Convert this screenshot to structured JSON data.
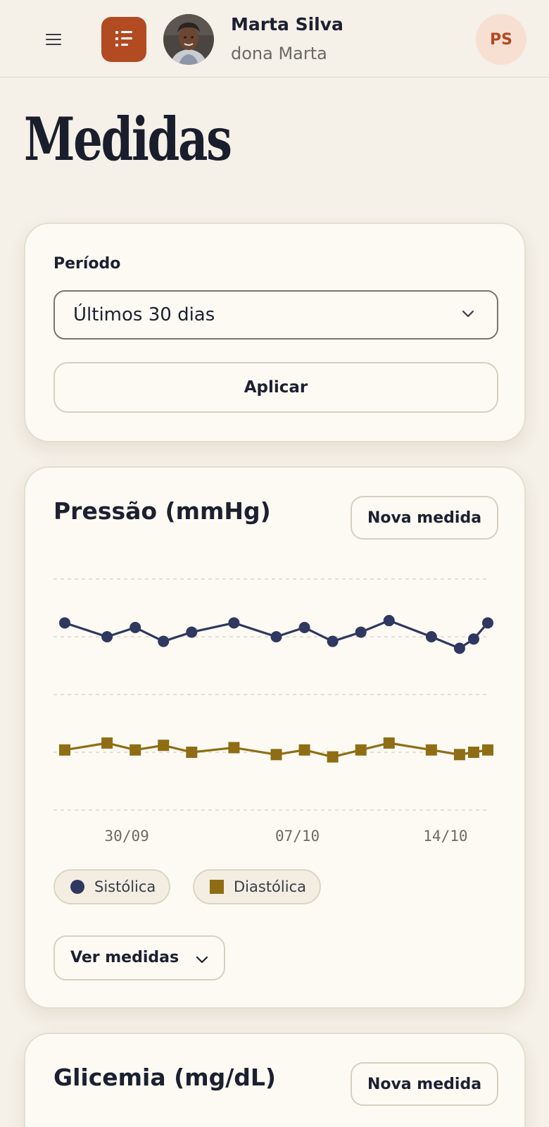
{
  "header": {
    "patient_name": "Marta Silva",
    "patient_nickname": "dona Marta",
    "user_initials": "PS"
  },
  "page": {
    "title": "Medidas"
  },
  "filter": {
    "label": "Período",
    "selected": "Últimos 30 dias",
    "apply_label": "Aplicar"
  },
  "pressure": {
    "title": "Pressão (mmHg)",
    "new_label": "Nova medida",
    "view_label": "Ver medidas",
    "legend": {
      "systolic": "Sistólica",
      "diastolic": "Diastólica"
    }
  },
  "glycemia": {
    "title": "Glicemia (mg/dL)",
    "new_label": "Nova medida"
  },
  "colors": {
    "accent": "#b24a22",
    "systolic": "#2e3860",
    "diastolic": "#8f6d14",
    "background": "#f5f0e8",
    "card": "#fdfaf4"
  },
  "icons": {
    "menu": "hamburger-menu-icon",
    "list": "list-icon",
    "dropdown": "chevron-down-icon"
  },
  "chart_data": {
    "type": "line",
    "title": "Pressão (mmHg)",
    "xlabel": "",
    "ylabel": "",
    "grid": true,
    "ylim": [
      60,
      160
    ],
    "x_labels": [
      "30/09",
      "07/10",
      "14/10"
    ],
    "x": [
      0,
      3,
      5,
      7,
      9,
      12,
      15,
      17,
      19,
      21,
      23,
      26,
      28,
      29,
      30
    ],
    "series": [
      {
        "name": "Sistólica",
        "marker": "circle",
        "values": [
          141,
          135,
          139,
          133,
          137,
          141,
          135,
          139,
          133,
          137,
          142,
          135,
          130,
          134,
          141
        ]
      },
      {
        "name": "Diastólica",
        "marker": "square",
        "values": [
          86,
          89,
          86,
          88,
          85,
          87,
          84,
          86,
          83,
          86,
          89,
          86,
          84,
          85,
          86
        ]
      }
    ]
  }
}
